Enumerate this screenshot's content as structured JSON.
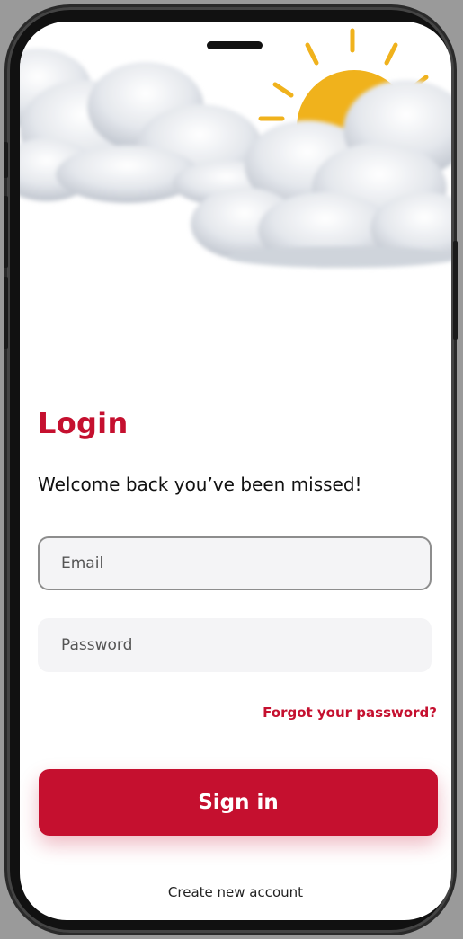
{
  "login": {
    "title": "Login",
    "subtitle": "Welcome back you’ve been missed!",
    "email_placeholder": "Email",
    "password_placeholder": "Password",
    "forgot_label": "Forgot your password?",
    "signin_label": "Sign in",
    "create_label": "Create new account"
  },
  "colors": {
    "accent": "#c5102f",
    "sun": "#f0b21c",
    "field_bg": "#f4f4f6",
    "field_border": "#8d8d8d"
  },
  "icons": {
    "hero": [
      "sun-icon",
      "clouds-illustration"
    ]
  }
}
